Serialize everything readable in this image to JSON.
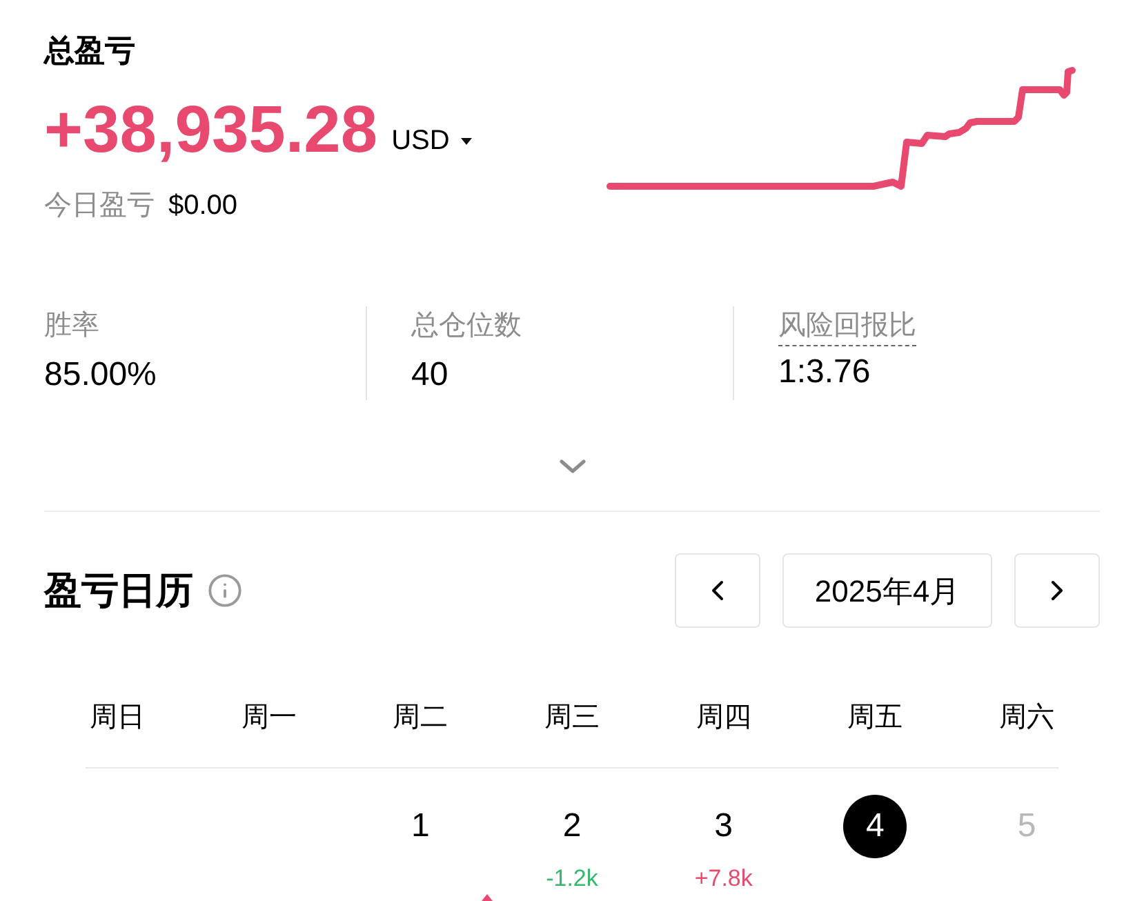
{
  "summary": {
    "title": "总盈亏",
    "total": "+38,935.28",
    "currency": "USD",
    "today_label": "今日盈亏",
    "today_value": "$0.00"
  },
  "stats": [
    {
      "label": "胜率",
      "value": "85.00%",
      "dashed": false
    },
    {
      "label": "总仓位数",
      "value": "40",
      "dashed": false
    },
    {
      "label": "风险回报比",
      "value": "1:3.76",
      "dashed": true
    }
  ],
  "stats_expanded": false,
  "calendar": {
    "title": "盈亏日历",
    "month": "2025年4月",
    "weekdays": [
      "周日",
      "周一",
      "周二",
      "周三",
      "周四",
      "周五",
      "周六"
    ],
    "weeks": [
      [
        {
          "kind": "blank"
        },
        {
          "kind": "blank"
        },
        {
          "kind": "day",
          "day": "1",
          "selected": false,
          "disabled": false
        },
        {
          "kind": "day",
          "day": "2",
          "selected": false,
          "disabled": false,
          "pnl": {
            "text": "-1.2k",
            "color": "#34b86b"
          }
        },
        {
          "kind": "day",
          "day": "3",
          "selected": false,
          "disabled": false,
          "pnl": {
            "text": "+7.8k",
            "color": "#e84a6f"
          }
        },
        {
          "kind": "day",
          "day": "4",
          "selected": true,
          "disabled": false
        },
        {
          "kind": "day",
          "day": "5",
          "selected": false,
          "disabled": true
        }
      ]
    ]
  }
}
